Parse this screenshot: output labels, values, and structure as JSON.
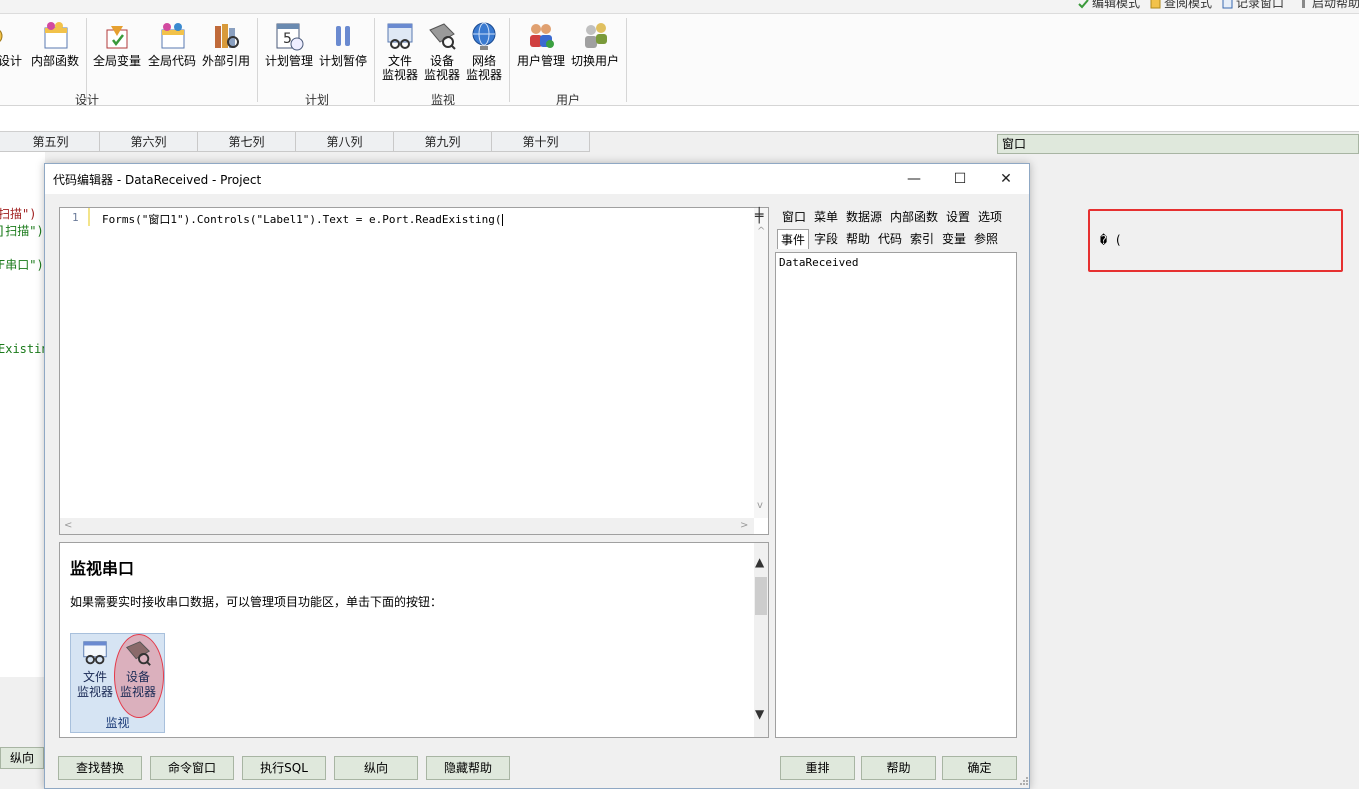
{
  "quick_toolbar": [
    {
      "label": "编辑模式",
      "icon": "edit-mode-icon"
    },
    {
      "label": "查阅模式",
      "icon": "browse-mode-icon"
    },
    {
      "label": "记录窗口",
      "icon": "record-window-icon"
    },
    {
      "label": "启动帮助",
      "icon": "startup-help-icon"
    }
  ],
  "ribbon": {
    "groups": [
      {
        "label": "设计",
        "buttons": [
          {
            "label": "设计",
            "icon": "design-icon"
          },
          {
            "label": "内部函数",
            "icon": "internal-function-icon"
          },
          {
            "label": "全局变量",
            "icon": "global-variable-icon"
          },
          {
            "label": "全局代码",
            "icon": "global-code-icon"
          },
          {
            "label": "外部引用",
            "icon": "external-reference-icon"
          }
        ]
      },
      {
        "label": "计划",
        "buttons": [
          {
            "label": "计划管理",
            "icon": "schedule-calendar-icon"
          },
          {
            "label": "计划暂停",
            "icon": "pause-icon"
          }
        ]
      },
      {
        "label": "监视",
        "buttons": [
          {
            "label": "文件\n监视器",
            "icon": "file-monitor-icon"
          },
          {
            "label": "设备\n监视器",
            "icon": "device-monitor-icon"
          },
          {
            "label": "网络\n监视器",
            "icon": "network-monitor-icon"
          }
        ]
      },
      {
        "label": "用户",
        "buttons": [
          {
            "label": "用户管理",
            "icon": "user-management-icon"
          },
          {
            "label": "切换用户",
            "icon": "switch-user-icon"
          }
        ]
      }
    ]
  },
  "grid": {
    "columns": [
      "第五列",
      "第六列",
      "第七列",
      "第八列",
      "第九列",
      "第十列"
    ]
  },
  "background_code": {
    "lines": [
      "扫描\")",
      "]扫描\")",
      "F串口\")",
      "Existin"
    ]
  },
  "background_button": "纵向",
  "right_panel": {
    "header": "窗口",
    "label_text": "� ("
  },
  "editor": {
    "title": "代码编辑器 - DataReceived - Project",
    "window_controls": {
      "minimize": "—",
      "maximize": "☐",
      "close": "✕"
    },
    "code": {
      "line_number": "1",
      "line": "Forms(\"窗口1\").Controls(\"Label1\").Text = e.Port.ReadExisting("
    },
    "help": {
      "title": "监视串口",
      "description": "如果需要实时接收串口数据，可以管理项目功能区，单击下面的按钮：",
      "mini_ribbon": {
        "buttons": [
          {
            "label": "文件\n监视器",
            "icon": "file-monitor-icon"
          },
          {
            "label": "设备\n监视器",
            "icon": "device-monitor-icon"
          }
        ],
        "group_label": "监视"
      }
    },
    "prop_tabs_row1": [
      "窗口",
      "菜单",
      "数据源",
      "内部函数",
      "设置",
      "选项"
    ],
    "prop_tabs_row2": [
      "事件",
      "字段",
      "帮助",
      "代码",
      "索引",
      "变量",
      "参照"
    ],
    "prop_list": [
      "DataReceived"
    ],
    "bottom_buttons_left": [
      "查找替换",
      "命令窗口",
      "执行SQL",
      "纵向",
      "隐藏帮助"
    ],
    "bottom_buttons_right": [
      "重排",
      "帮助",
      "确定"
    ]
  }
}
